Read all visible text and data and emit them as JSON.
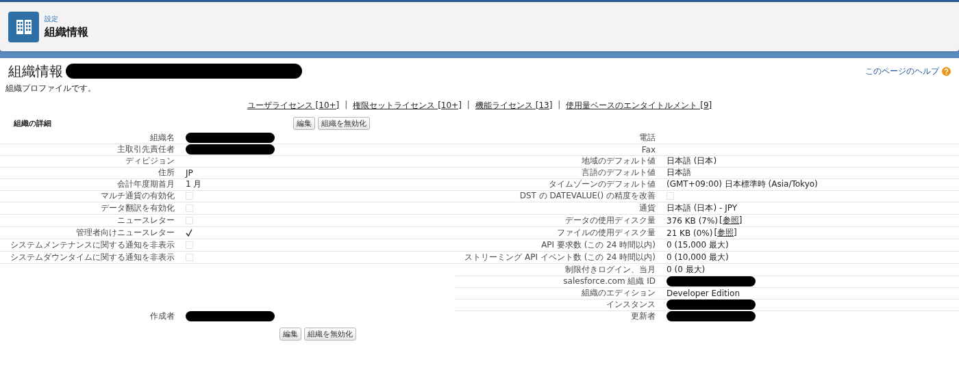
{
  "header": {
    "breadcrumb": "設定",
    "title": "組織情報"
  },
  "page": {
    "title": "組織情報",
    "title_redacted": true,
    "help_link": "このページのヘルプ",
    "description": "組織プロファイルです。"
  },
  "license_links": {
    "separator": "|",
    "items": [
      {
        "label": "ユーザライセンス [10+]"
      },
      {
        "label": "権限セットライセンス [10+]"
      },
      {
        "label": "機能ライセンス [13]"
      },
      {
        "label": "使用量ベースのエンタイトルメント [9]"
      }
    ]
  },
  "section": {
    "title": "組織の詳細",
    "buttons": [
      "編集",
      "組織を無効化"
    ]
  },
  "rows": [
    {
      "left": {
        "label": "組織名",
        "kind": "text",
        "redacted": true
      },
      "right": {
        "label": "電話",
        "kind": "text"
      }
    },
    {
      "left": {
        "label": "主取引先責任者",
        "kind": "text",
        "redacted": true
      },
      "right": {
        "label": "Fax",
        "kind": "text"
      }
    },
    {
      "left": {
        "label": "ディビジョン",
        "kind": "text"
      },
      "right": {
        "label": "地域のデフォルト値",
        "kind": "text",
        "value": "日本語 (日本)"
      }
    },
    {
      "left": {
        "label": "住所",
        "kind": "text",
        "value": "JP"
      },
      "right": {
        "label": "言語のデフォルト値",
        "kind": "text",
        "value": "日本語"
      }
    },
    {
      "left": {
        "label": "会計年度期首月",
        "kind": "text",
        "value": "1 月"
      },
      "right": {
        "label": "タイムゾーンのデフォルト値",
        "kind": "text",
        "value": "(GMT+09:00) 日本標準時 (Asia/Tokyo)"
      }
    },
    {
      "left": {
        "label": "マルチ通貨の有効化",
        "kind": "checkbox",
        "checked": false
      },
      "right": {
        "label": "DST の DATEVALUE() の精度を改善",
        "kind": "checkbox",
        "checked": false
      }
    },
    {
      "left": {
        "label": "データ翻訳を有効化",
        "kind": "checkbox",
        "checked": false
      },
      "right": {
        "label": "通貨",
        "kind": "text",
        "value": "日本語 (日本) - JPY"
      }
    },
    {
      "left": {
        "label": "ニュースレター",
        "kind": "checkbox",
        "checked": false
      },
      "right": {
        "label": "データの使用ディスク量",
        "kind": "link",
        "value": "376 KB (7%)",
        "link": "[参照]"
      }
    },
    {
      "left": {
        "label": "管理者向けニュースレター",
        "kind": "checkbox",
        "checked": true
      },
      "right": {
        "label": "ファイルの使用ディスク量",
        "kind": "link",
        "value": "21 KB (0%)",
        "link": "[参照]"
      }
    },
    {
      "left": {
        "label": "システムメンテナンスに関する通知を非表示",
        "kind": "checkbox",
        "checked": false
      },
      "right": {
        "label": "API 要求数 (この 24 時間以内)",
        "kind": "text",
        "value": "0 (15,000 最大)"
      }
    },
    {
      "left": {
        "label": "システムダウンタイムに関する通知を非表示",
        "kind": "checkbox",
        "checked": false
      },
      "right": {
        "label": "ストリーミング API イベント数 (この 24 時間以内)",
        "kind": "text",
        "value": "0 (10,000 最大)"
      }
    },
    {
      "right": {
        "label": "制限付きログイン、当月",
        "kind": "text",
        "value": "0 (0 最大)"
      }
    },
    {
      "right": {
        "label": "salesforce.com 組織 ID",
        "kind": "text",
        "redacted": true
      }
    },
    {
      "right": {
        "label": "組織のエディション",
        "kind": "text",
        "value": "Developer Edition"
      }
    },
    {
      "right": {
        "label": "インスタンス",
        "kind": "text",
        "redacted": true
      }
    },
    {
      "left": {
        "label": "作成者",
        "kind": "text",
        "redacted": true
      },
      "right": {
        "label": "更新者",
        "kind": "text",
        "redacted": true
      }
    }
  ],
  "bottom_buttons": [
    "編集",
    "組織を無効化"
  ]
}
